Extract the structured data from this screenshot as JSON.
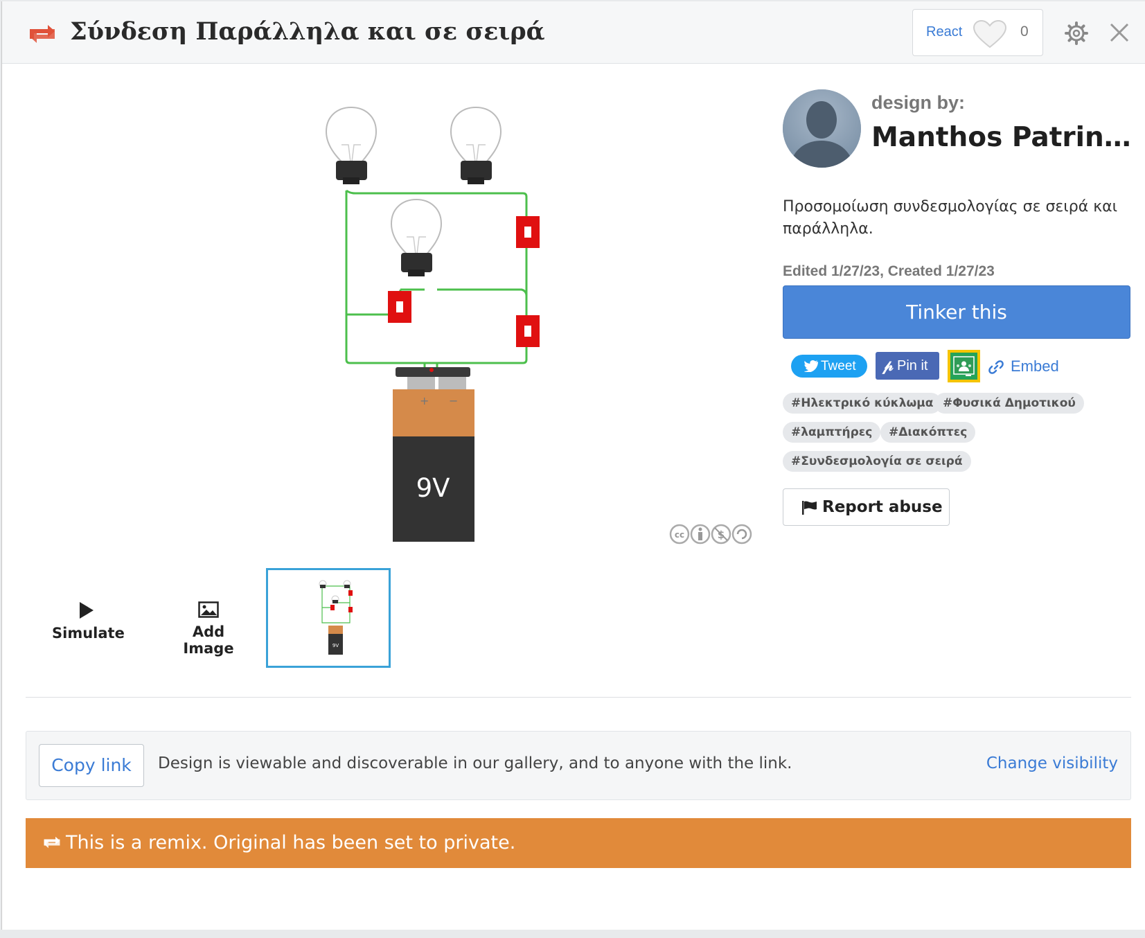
{
  "header": {
    "title": "Σύνδεση Παράλληλα και σε σειρά",
    "react_label": "React",
    "react_count": "0"
  },
  "canvas": {
    "battery_label": "9V",
    "battery_plus": "+",
    "battery_minus": "−"
  },
  "tools": {
    "simulate_label": "Simulate",
    "add_image_label": "Add Image",
    "thumb_battery_label": "9V"
  },
  "designer": {
    "design_by_label": "design by:",
    "name": "Manthos Patrinop..."
  },
  "description": "Προσομοίωση συνδεσμολογίας σε σειρά και παράλληλα.",
  "dates": "Edited 1/27/23, Created 1/27/23",
  "actions": {
    "tinker_label": "Tinker this",
    "tweet_label": "Tweet",
    "pin_label": "Pin it",
    "embed_label": "Embed",
    "report_label": "Report abuse"
  },
  "tags": [
    "#Ηλεκτρικό κύκλωμα",
    "#Φυσικά Δημοτικού",
    "#λαμπτήρες",
    "#Διακόπτες",
    "#Συνδεσμολογία σε σειρά"
  ],
  "share": {
    "copy_link_label": "Copy link",
    "visibility_text": "Design is viewable and discoverable in our gallery, and to anyone with the link.",
    "change_visibility_label": "Change visibility"
  },
  "remix_notice": "This is a remix. Original has been set to private.",
  "colors": {
    "primary_blue": "#4a86d8",
    "link_blue": "#3a7bd5",
    "remix_orange": "#e18a3a",
    "remix_icon_red": "#e0523a",
    "wire_green": "#4cbf4c",
    "switch_red": "#e01010"
  }
}
